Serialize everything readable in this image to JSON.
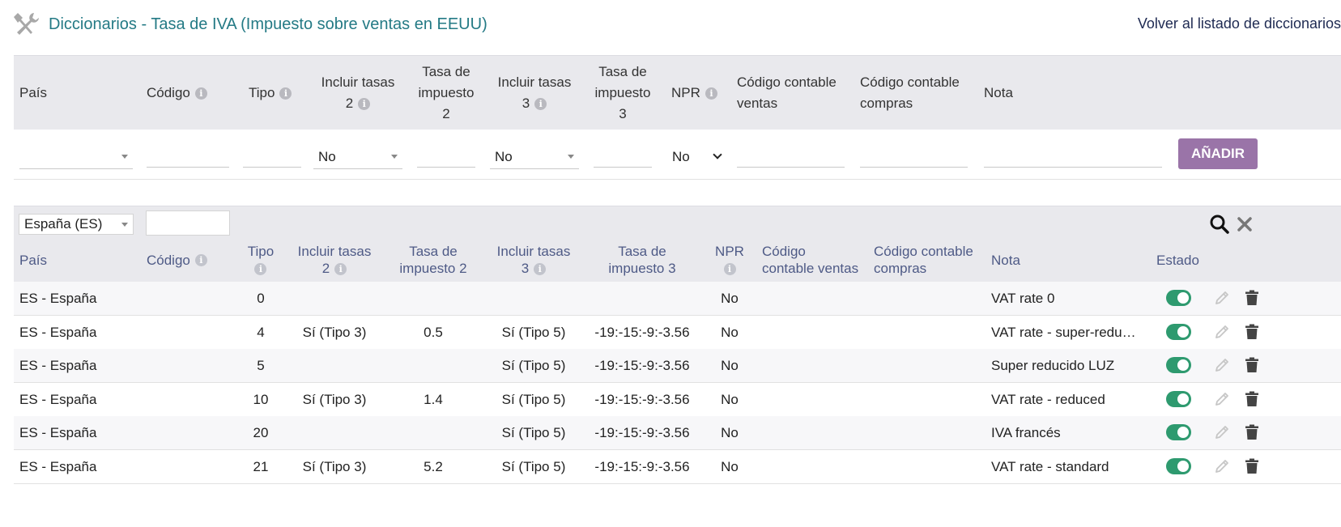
{
  "header": {
    "title": "Diccionarios - Tasa de IVA (Impuesto sobre ventas en EEUU)",
    "back_link": "Volver al listado de diccionarios",
    "icon": "tools-icon"
  },
  "add_form": {
    "columns": {
      "pais": "País",
      "codigo": "Código",
      "tipo": "Tipo",
      "incluir2_a": "Incluir tasas",
      "incluir2_b": "2",
      "tasa2_a": "Tasa de",
      "tasa2_b": "impuesto",
      "tasa2_c": "2",
      "incluir3_a": "Incluir tasas",
      "incluir3_b": "3",
      "tasa3_a": "Tasa de",
      "tasa3_b": "impuesto",
      "tasa3_c": "3",
      "npr": "NPR",
      "cc_ventas_a": "Código contable",
      "cc_ventas_b": "ventas",
      "cc_compras_a": "Código contable",
      "cc_compras_b": "compras",
      "nota": "Nota"
    },
    "inputs": {
      "pais": "",
      "codigo": "",
      "tipo": "",
      "incluir2": "No",
      "tasa2": "",
      "incluir3": "No",
      "tasa3": "",
      "npr": "No",
      "cc_ventas": "",
      "cc_compras": "",
      "nota": ""
    },
    "add_button": "AÑADIR",
    "add_button_color": "#9a74a8"
  },
  "list": {
    "filter_country": "España (ES)",
    "filter_code": "",
    "columns": {
      "pais": "País",
      "codigo": "Código",
      "tipo": "Tipo",
      "incluir2_a": "Incluir tasas",
      "incluir2_b": "2",
      "tasa2_a": "Tasa de",
      "tasa2_b": "impuesto 2",
      "incluir3_a": "Incluir tasas",
      "incluir3_b": "3",
      "tasa3_a": "Tasa de",
      "tasa3_b": "impuesto 3",
      "npr": "NPR",
      "cc_ventas_a": "Código",
      "cc_ventas_b": "contable ventas",
      "cc_compras_a": "Código contable",
      "cc_compras_b": "compras",
      "nota": "Nota",
      "estado": "Estado"
    },
    "rows": [
      {
        "pais": "ES - España",
        "tipo": "0",
        "incluir2": "",
        "tasa2": "",
        "incluir3": "",
        "tasa3": "",
        "npr": "No",
        "nota": "VAT rate 0",
        "estado": "on"
      },
      {
        "pais": "ES - España",
        "tipo": "4",
        "incluir2": "Sí (Tipo 3)",
        "tasa2": "0.5",
        "incluir3": "Sí (Tipo 5)",
        "tasa3": "-19:-15:-9:-3.56",
        "npr": "No",
        "nota": "VAT rate - super-reduced",
        "estado": "on"
      },
      {
        "pais": "ES - España",
        "tipo": "5",
        "incluir2": "",
        "tasa2": "",
        "incluir3": "Sí (Tipo 5)",
        "tasa3": "-19:-15:-9:-3.56",
        "npr": "No",
        "nota": "Super reducido LUZ",
        "estado": "on"
      },
      {
        "pais": "ES - España",
        "tipo": "10",
        "incluir2": "Sí (Tipo 3)",
        "tasa2": "1.4",
        "incluir3": "Sí (Tipo 5)",
        "tasa3": "-19:-15:-9:-3.56",
        "npr": "No",
        "nota": "VAT rate - reduced",
        "estado": "on"
      },
      {
        "pais": "ES - España",
        "tipo": "20",
        "incluir2": "",
        "tasa2": "",
        "incluir3": "Sí (Tipo 5)",
        "tasa3": "-19:-15:-9:-3.56",
        "npr": "No",
        "nota": "IVA francés",
        "estado": "on"
      },
      {
        "pais": "ES - España",
        "tipo": "21",
        "incluir2": "Sí (Tipo 3)",
        "tasa2": "5.2",
        "incluir3": "Sí (Tipo 5)",
        "tasa3": "-19:-15:-9:-3.56",
        "npr": "No",
        "nota": "VAT rate - standard",
        "estado": "on"
      }
    ],
    "toggle_color": "#2e9a6f"
  }
}
